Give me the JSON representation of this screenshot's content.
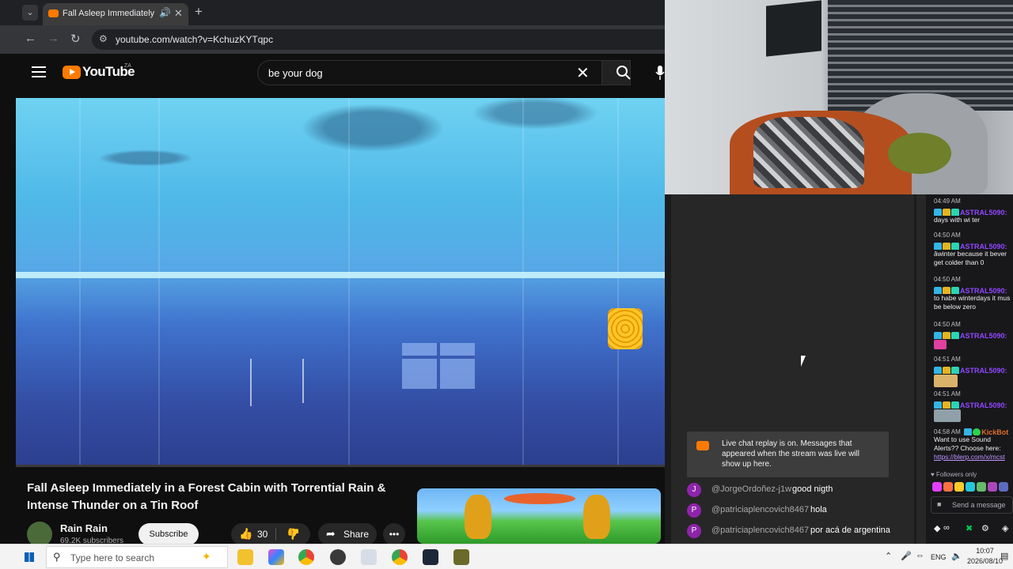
{
  "browser": {
    "tab_title": "Fall Asleep Immediately in a",
    "url": "youtube.com/watch?v=KchuzKYTqpc"
  },
  "youtube": {
    "logo_text": "YouTube",
    "region": "ZA",
    "search_query": "be your dog",
    "video_title": "Fall Asleep Immediately in a Forest Cabin with Torrential Rain & Intense Thunder on a Tin Roof",
    "channel_name": "Rain Rain",
    "subscribers": "69.2K subscribers",
    "subscribe_label": "Subscribe",
    "like_count": "30",
    "share_label": "Share"
  },
  "live_chat": {
    "notice": "Live chat replay is on. Messages that appeared when the stream was live will show up here.",
    "messages": [
      {
        "initial": "J",
        "author": "@JorgeOrdoñez-j1w",
        "text": "good nigth"
      },
      {
        "initial": "P",
        "author": "@patriciaplencovich8467",
        "text": "hola"
      },
      {
        "initial": "P",
        "author": "@patriciaplencovich8467",
        "text": "por acá de argentina"
      }
    ]
  },
  "twitch_chat": {
    "messages": [
      {
        "time": "04:49 AM",
        "user": "ASTRAL5090:",
        "text": "days with wi ter"
      },
      {
        "time": "04:50 AM",
        "user": "ASTRAL5090:",
        "text": "âwinter because it bever",
        "text2": "get colder than 0"
      },
      {
        "time": "04:50 AM",
        "user": "ASTRAL5090:",
        "text": "to habe winterdays it mus",
        "text2": "be below zero"
      },
      {
        "time": "04:50 AM",
        "user": "ASTRAL5090:",
        "text": ""
      },
      {
        "time": "04:51 AM",
        "user": "ASTRAL5090:",
        "text": ""
      },
      {
        "time": "04:51 AM",
        "user": "ASTRAL5090:",
        "text": ""
      },
      {
        "time": "04:58 AM",
        "user": "KickBot",
        "text": "Want to use Sound",
        "text2": "Alerts?? Choose here:",
        "link": "https://blerp.com/x/mcst"
      }
    ],
    "followers_only": "Followers only",
    "input_placeholder": "Send a message"
  },
  "taskbar": {
    "search_placeholder": "Type here to search",
    "language": "ENG",
    "time": "10:07",
    "date": "2026/08/10"
  },
  "colors": {
    "accent": "#ff7a00",
    "twitch_purple": "#9147ff",
    "youtube_bg": "#0f0f0f"
  }
}
